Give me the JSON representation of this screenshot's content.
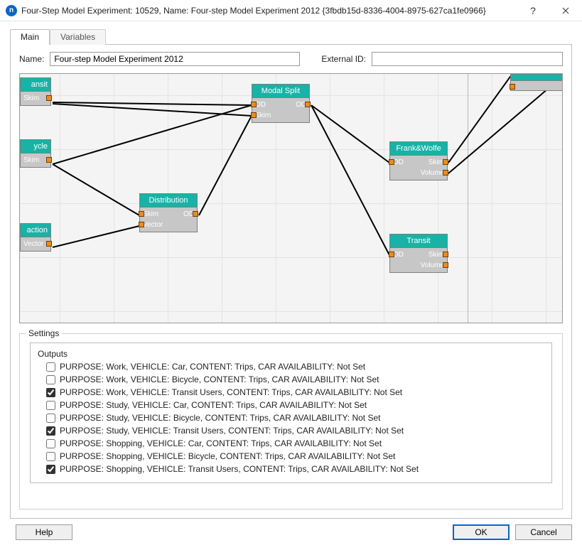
{
  "window": {
    "title": "Four-Step Model Experiment: 10529, Name: Four-step Model Experiment 2012  {3fbdb15d-8336-4004-8975-627ca1fe0966}",
    "help_glyph": "?",
    "close_glyph": "×"
  },
  "tabs": {
    "main": "Main",
    "variables": "Variables"
  },
  "form": {
    "name_label": "Name:",
    "name_value": "Four-step Model Experiment 2012",
    "external_id_label": "External ID:",
    "external_id_value": ""
  },
  "nodes": {
    "transit_top": {
      "title": "ansit",
      "port1": "Skim"
    },
    "cycle": {
      "title": "ycle",
      "port1": "Skim"
    },
    "action": {
      "title": "action",
      "port1": "Vector"
    },
    "modal_split": {
      "title": "Modal Split",
      "left1": "OD",
      "right1": "OD",
      "left2": "Skim"
    },
    "distribution": {
      "title": "Distribution",
      "left1": "Skim",
      "right1": "OD",
      "left2": "Vector"
    },
    "frank_wolfe": {
      "title": "Frank&Wolfe",
      "left1": "OD",
      "right1": "Skim",
      "right2": "Volume"
    },
    "transit_right": {
      "title": "Transit",
      "left1": "OD",
      "right1": "Skim",
      "right2": "Volume"
    },
    "large_top_right": {
      "title": ""
    }
  },
  "settings": {
    "legend": "Settings",
    "outputs_legend": "Outputs",
    "outputs": [
      {
        "checked": false,
        "label": "PURPOSE: Work, VEHICLE: Car, CONTENT: Trips, CAR AVAILABILITY: Not Set"
      },
      {
        "checked": false,
        "label": "PURPOSE: Work, VEHICLE: Bicycle, CONTENT: Trips, CAR AVAILABILITY: Not Set"
      },
      {
        "checked": true,
        "label": "PURPOSE: Work, VEHICLE: Transit Users, CONTENT: Trips, CAR AVAILABILITY: Not Set"
      },
      {
        "checked": false,
        "label": "PURPOSE: Study, VEHICLE: Car, CONTENT: Trips, CAR AVAILABILITY: Not Set"
      },
      {
        "checked": false,
        "label": "PURPOSE: Study, VEHICLE: Bicycle, CONTENT: Trips, CAR AVAILABILITY: Not Set"
      },
      {
        "checked": true,
        "label": "PURPOSE: Study, VEHICLE: Transit Users, CONTENT: Trips, CAR AVAILABILITY: Not Set"
      },
      {
        "checked": false,
        "label": "PURPOSE: Shopping, VEHICLE: Car, CONTENT: Trips, CAR AVAILABILITY: Not Set"
      },
      {
        "checked": false,
        "label": "PURPOSE: Shopping, VEHICLE: Bicycle, CONTENT: Trips, CAR AVAILABILITY: Not Set"
      },
      {
        "checked": true,
        "label": "PURPOSE: Shopping, VEHICLE: Transit Users, CONTENT: Trips, CAR AVAILABILITY: Not Set"
      }
    ]
  },
  "buttons": {
    "help": "Help",
    "ok": "OK",
    "cancel": "Cancel"
  }
}
